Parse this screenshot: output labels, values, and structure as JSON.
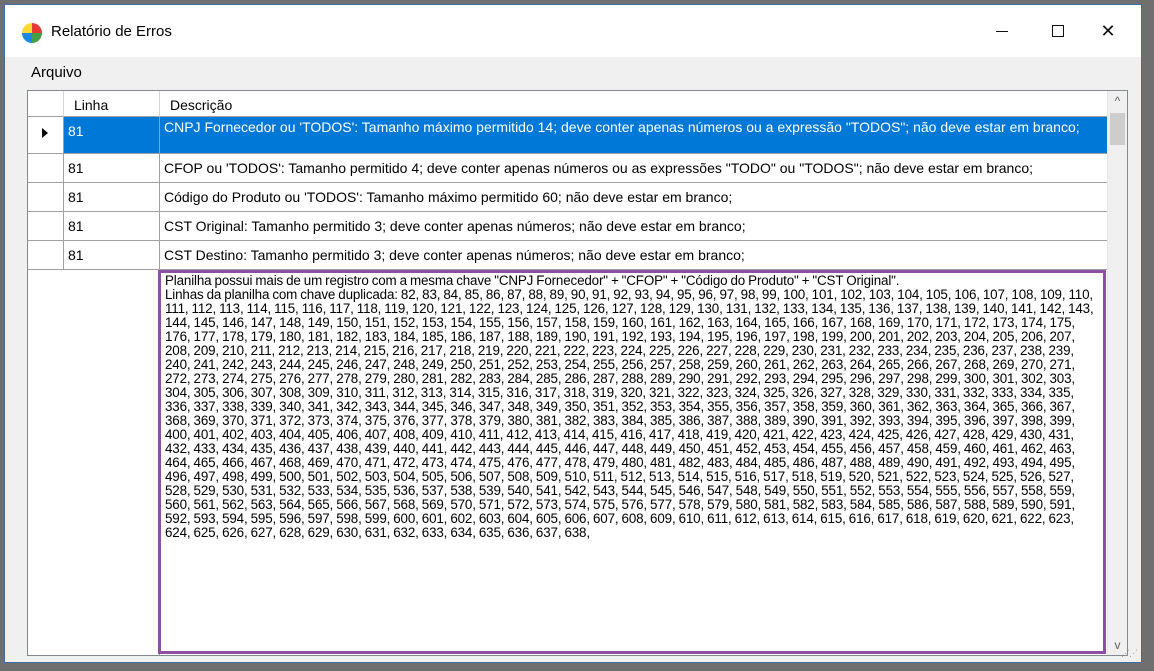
{
  "window": {
    "title": "Relatório de Erros",
    "icon": "app-globe-icon",
    "controls": {
      "minimize": "—",
      "maximize": "☐",
      "close": "✕"
    }
  },
  "menu": {
    "items": [
      {
        "label": "Arquivo"
      }
    ]
  },
  "grid": {
    "columns": {
      "linha": "Linha",
      "descricao": "Descrição"
    },
    "rows": [
      {
        "linha": "81",
        "descricao": "CNPJ Fornecedor ou 'TODOS': Tamanho máximo permitido 14; deve conter apenas números ou a expressão \"TODOS\"; não deve estar em branco;",
        "selected": true
      },
      {
        "linha": "81",
        "descricao": "CFOP ou 'TODOS': Tamanho permitido 4; deve conter apenas números ou as expressões \"TODO\" ou \"TODOS\"; não deve estar em branco;"
      },
      {
        "linha": "81",
        "descricao": "Código do Produto ou 'TODOS': Tamanho máximo permitido 60; não deve estar em branco;"
      },
      {
        "linha": "81",
        "descricao": "CST Original: Tamanho permitido 3; deve conter apenas números; não deve estar em branco;"
      },
      {
        "linha": "81",
        "descricao": "CST Destino: Tamanho permitido 3; deve conter apenas números; não deve estar em branco;"
      }
    ],
    "duplicate_row": {
      "linha": "",
      "line1": "Planilha possui mais de um registro com a mesma chave \"CNPJ Fornecedor\" + \"CFOP\" + \"Código do Produto\" + \"CST Original\".",
      "line2": "Linhas da planilha com chave duplicada: 82, 83, 84, 85, 86, 87, 88, 89, 90, 91, 92, 93, 94, 95, 96, 97, 98, 99, 100, 101, 102, 103, 104, 105, 106, 107, 108, 109, 110, 111, 112, 113, 114, 115, 116, 117, 118, 119, 120, 121, 122, 123, 124, 125, 126, 127, 128, 129, 130, 131, 132, 133, 134, 135, 136, 137, 138, 139, 140, 141, 142, 143, 144, 145, 146, 147, 148, 149, 150, 151, 152, 153, 154, 155, 156, 157, 158, 159, 160, 161, 162, 163, 164, 165, 166, 167, 168, 169, 170, 171, 172, 173, 174, 175, 176, 177, 178, 179, 180, 181, 182, 183, 184, 185, 186, 187, 188, 189, 190, 191, 192, 193, 194, 195, 196, 197, 198, 199, 200, 201, 202, 203, 204, 205, 206, 207, 208, 209, 210, 211, 212, 213, 214, 215, 216, 217, 218, 219, 220, 221, 222, 223, 224, 225, 226, 227, 228, 229, 230, 231, 232, 233, 234, 235, 236, 237, 238, 239, 240, 241, 242, 243, 244, 245, 246, 247, 248, 249, 250, 251, 252, 253, 254, 255, 256, 257, 258, 259, 260, 261, 262, 263, 264, 265, 266, 267, 268, 269, 270, 271, 272, 273, 274, 275, 276, 277, 278, 279, 280, 281, 282, 283, 284, 285, 286, 287, 288, 289, 290, 291, 292, 293, 294, 295, 296, 297, 298, 299, 300, 301, 302, 303, 304, 305, 306, 307, 308, 309, 310, 311, 312, 313, 314, 315, 316, 317, 318, 319, 320, 321, 322, 323, 324, 325, 326, 327, 328, 329, 330, 331, 332, 333, 334, 335, 336, 337, 338, 339, 340, 341, 342, 343, 344, 345, 346, 347, 348, 349, 350, 351, 352, 353, 354, 355, 356, 357, 358, 359, 360, 361, 362, 363, 364, 365, 366, 367, 368, 369, 370, 371, 372, 373, 374, 375, 376, 377, 378, 379, 380, 381, 382, 383, 384, 385, 386, 387, 388, 389, 390, 391, 392, 393, 394, 395, 396, 397, 398, 399, 400, 401, 402, 403, 404, 405, 406, 407, 408, 409, 410, 411, 412, 413, 414, 415, 416, 417, 418, 419, 420, 421, 422, 423, 424, 425, 426, 427, 428, 429, 430, 431, 432, 433, 434, 435, 436, 437, 438, 439, 440, 441, 442, 443, 444, 445, 446, 447, 448, 449, 450, 451, 452, 453, 454, 455, 456, 457, 458, 459, 460, 461, 462, 463, 464, 465, 466, 467, 468, 469, 470, 471, 472, 473, 474, 475, 476, 477, 478, 479, 480, 481, 482, 483, 484, 485, 486, 487, 488, 489, 490, 491, 492, 493, 494, 495, 496, 497, 498, 499, 500, 501, 502, 503, 504, 505, 506, 507, 508, 509, 510, 511, 512, 513, 514, 515, 516, 517, 518, 519, 520, 521, 522, 523, 524, 525, 526, 527, 528, 529, 530, 531, 532, 533, 534, 535, 536, 537, 538, 539, 540, 541, 542, 543, 544, 545, 546, 547, 548, 549, 550, 551, 552, 553, 554, 555, 556, 557, 558, 559, 560, 561, 562, 563, 564, 565, 566, 567, 568, 569, 570, 571, 572, 573, 574, 575, 576, 577, 578, 579, 580, 581, 582, 583, 584, 585, 586, 587, 588, 589, 590, 591, 592, 593, 594, 595, 596, 597, 598, 599, 600, 601, 602, 603, 604, 605, 606, 607, 608, 609, 610, 611, 612, 613, 614, 615, 616, 617, 618, 619, 620, 621, 622, 623, 624, 625, 626, 627, 628, 629, 630, 631, 632, 633, 634, 635, 636, 637, 638,"
    }
  },
  "scrollbar": {
    "up": "^",
    "down": "v"
  },
  "colors": {
    "selection": "#0078d7",
    "highlight_border": "#8e4fa0",
    "grid_line": "#a0a0a0"
  }
}
